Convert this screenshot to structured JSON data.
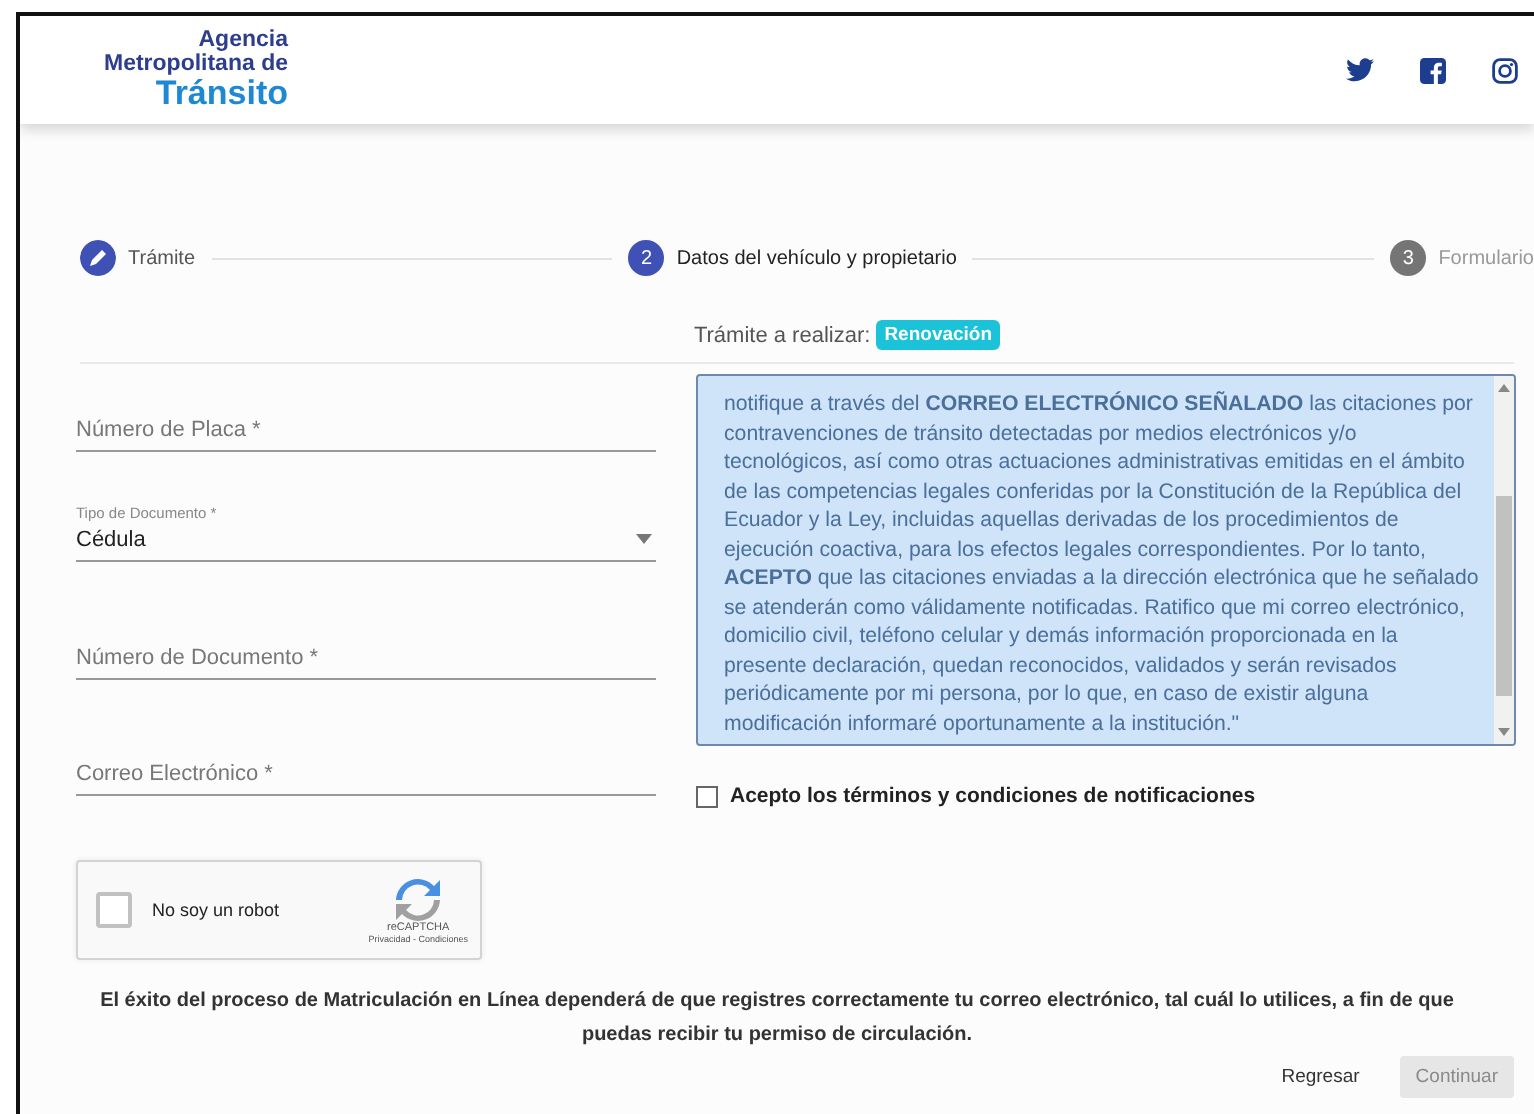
{
  "header": {
    "logo_lines": [
      "Agencia",
      "Metropolitana de",
      "Tránsito"
    ]
  },
  "stepper": [
    {
      "label": "Trámite",
      "completed": true,
      "selected": false
    },
    {
      "number": "2",
      "label": "Datos del vehículo y propietario",
      "completed": false,
      "selected": true
    },
    {
      "number": "3",
      "label": "Formulario",
      "completed": false,
      "selected": false
    }
  ],
  "procedure": {
    "label": "Trámite a realizar:",
    "badge": "Renovación"
  },
  "fields": [
    {
      "kind": "input",
      "placeholder": "Número de Placa *"
    },
    {
      "kind": "select",
      "label": "Tipo de Documento *",
      "value": "Cédula"
    },
    {
      "kind": "input",
      "placeholder": "Número de Documento *"
    },
    {
      "kind": "input",
      "placeholder": "Correo Electrónico *"
    }
  ],
  "captcha": {
    "label": "No soy un robot",
    "checked": false,
    "brand": "reCAPTCHA",
    "links": "Privacidad - Condiciones"
  },
  "terms": {
    "text": "notifique a través del **CORREO ELECTRÓNICO SEÑALADO** las citaciones por contravenciones de tránsito detectadas por medios electrónicos y/o tecnológicos, así como otras actuaciones administrativas emitidas en el ámbito de las competencias legales conferidas por la Constitución de la República del Ecuador y la Ley, incluidas aquellas derivadas de los procedimientos de ejecución coactiva, para los efectos legales correspondientes. Por lo tanto, **ACEPTO** que las citaciones enviadas a la dirección electrónica que he señalado se atenderán como válidamente notificadas. Ratifico que mi correo electrónico, domicilio civil, teléfono celular y demás información proporcionada en la presente declaración, quedan reconocidos, validados y serán revisados periódicamente por mi persona, por lo que, en caso de existir alguna modificación informaré oportunamente a la institución.\"",
    "accept_label": "Acepto los términos y condiciones de notificaciones",
    "accepted": false
  },
  "note": "El éxito del proceso de Matriculación en Línea dependerá de que registres correctamente tu correo electrónico, tal cuál lo utilices, a fin de que puedas recibir tu permiso de circulación.",
  "buttons": [
    {
      "label": "Regresar",
      "disabled": false
    },
    {
      "label": "Continuar",
      "disabled": true
    }
  ]
}
